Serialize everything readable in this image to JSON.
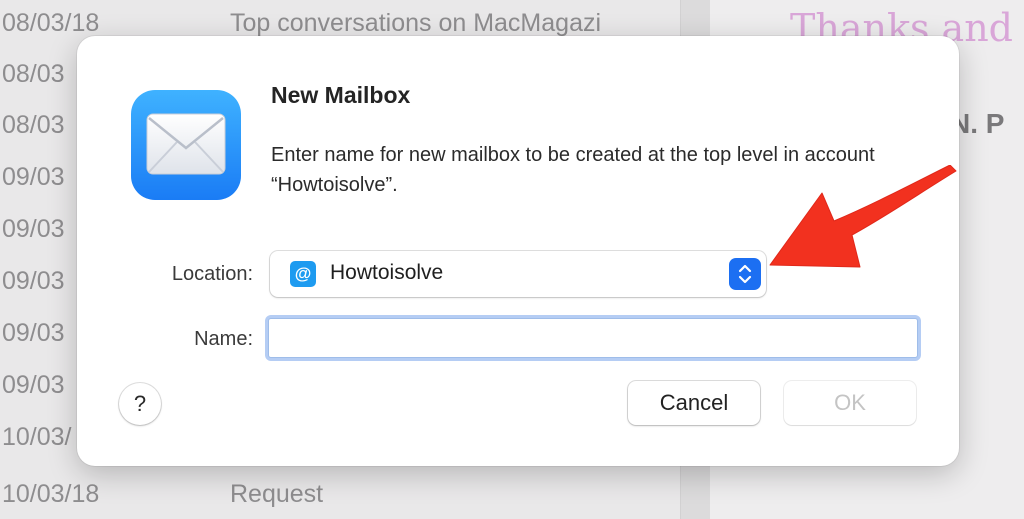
{
  "background": {
    "rows": [
      {
        "date": "08/03/18",
        "subject": "Top conversations on MacMagazi"
      },
      {
        "date": "08/03",
        "subject": ""
      },
      {
        "date": "08/03",
        "subject": ""
      },
      {
        "date": "09/03",
        "subject": ""
      },
      {
        "date": "09/03",
        "subject": ""
      },
      {
        "date": "09/03",
        "subject": ""
      },
      {
        "date": "09/03",
        "subject": ""
      },
      {
        "date": "09/03",
        "subject": ""
      },
      {
        "date": "10/03/",
        "subject": ""
      },
      {
        "date": "10/03/18",
        "subject": "Request"
      }
    ],
    "preview_greeting": "Thanks and",
    "preview_heading": "N. P"
  },
  "dialog": {
    "title": "New Mailbox",
    "message": "Enter name for new mailbox to be created at the top level in account “Howtoisolve”.",
    "location_label": "Location:",
    "location_value": "Howtoisolve",
    "location_icon_glyph": "@",
    "name_label": "Name:",
    "name_value": "",
    "help_label": "?",
    "cancel_label": "Cancel",
    "ok_label": "OK"
  },
  "icons": {
    "app": "mail-envelope-icon",
    "account": "at-sign-icon",
    "stepper": "chevron-up-down-icon",
    "annotation": "red-arrow-icon"
  },
  "colors": {
    "accent": "#1c6ff2",
    "arrow": "#f2311f",
    "app_icon_top": "#3fb2ff",
    "app_icon_bottom": "#1a7cf5"
  }
}
